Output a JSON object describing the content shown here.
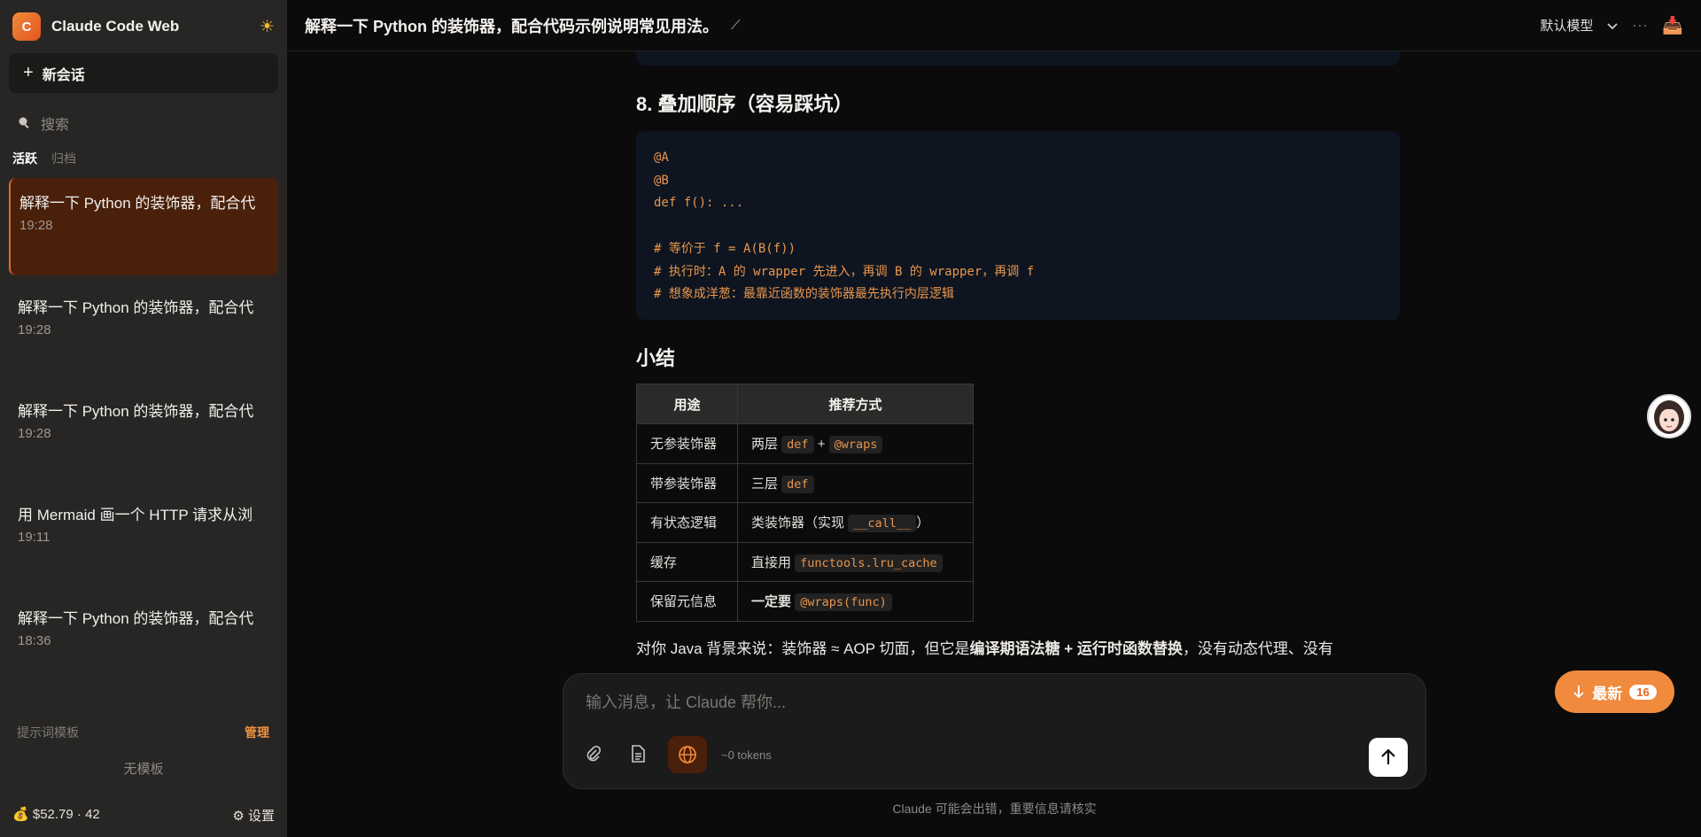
{
  "sidebar": {
    "brand_letter": "C",
    "brand_title": "Claude Code Web",
    "new_chat_label": "新会话",
    "search_placeholder": "搜索",
    "tabs": [
      "活跃",
      "归档"
    ],
    "conversations": [
      {
        "title": "解释一下 Python 的装饰器，配合代码示例说明常见用法。",
        "time": "19:28",
        "active": true
      },
      {
        "title": "解释一下 Python 的装饰器，配合代码示例说明常见用法。",
        "time": "19:28"
      },
      {
        "title": "解释一下 Python 的装饰器，配合代码示例说明常见用法。",
        "time": "19:28"
      },
      {
        "title": "用 Mermaid 画一个 HTTP 请求从浏览器到服务器的流程图",
        "time": "19:11"
      },
      {
        "title": "解释一下 Python 的装饰器，配合代码示例说明常见用法。",
        "time": "18:36"
      }
    ],
    "templates_label": "提示词模板",
    "templates_manage": "管理",
    "templates_empty": "无模板",
    "cost": "$52.79 · 42",
    "settings_label": "设置"
  },
  "topbar": {
    "title": "解释一下 Python 的装饰器，配合代码示例说明常见用法。",
    "model_label": "默认模型"
  },
  "main": {
    "section_heading": "8. 叠加顺序（容易踩坑）",
    "code": "@A\n@B\ndef f(): ...\n\n# 等价于 f = A(B(f))\n# 执行时：A 的 wrapper 先进入，再调 B 的 wrapper，再调 f\n# 想象成洋葱：最靠近函数的装饰器最先执行内层逻辑",
    "summary_heading": "小结",
    "table": {
      "headers": [
        "用途",
        "推荐方式"
      ],
      "rows": [
        {
          "use": "无参装饰器",
          "pre": "两层 ",
          "code1": "def",
          "mid": " + ",
          "code2": "@wraps",
          "post": ""
        },
        {
          "use": "带参装饰器",
          "pre": "三层 ",
          "code1": "def",
          "mid": "",
          "code2": "",
          "post": ""
        },
        {
          "use": "有状态逻辑",
          "pre": "类装饰器（实现 ",
          "code1": "__call__",
          "mid": "",
          "code2": "",
          "post": "）"
        },
        {
          "use": "缓存",
          "pre": "直接用 ",
          "code1": "functools.lru_cache",
          "mid": "",
          "code2": "",
          "post": ""
        },
        {
          "use": "保留元信息",
          "pre_bold": "一定要",
          "pre": " ",
          "code1": "@wraps(func)",
          "mid": "",
          "code2": "",
          "post": ""
        }
      ]
    },
    "para_start": "对你 Java 背景来说：装饰器 ≈ AOP 切面，但它是",
    "para_bold": "编译期语法糖 + 运行时函数替换",
    "para_end": "，没有动态代理、没有"
  },
  "composer": {
    "placeholder": "输入消息，让 Claude 帮你...",
    "tokens": "~0 tokens",
    "disclaimer": "Claude 可能会出错，重要信息请核实"
  },
  "latest": {
    "label": "最新",
    "count": "16"
  }
}
